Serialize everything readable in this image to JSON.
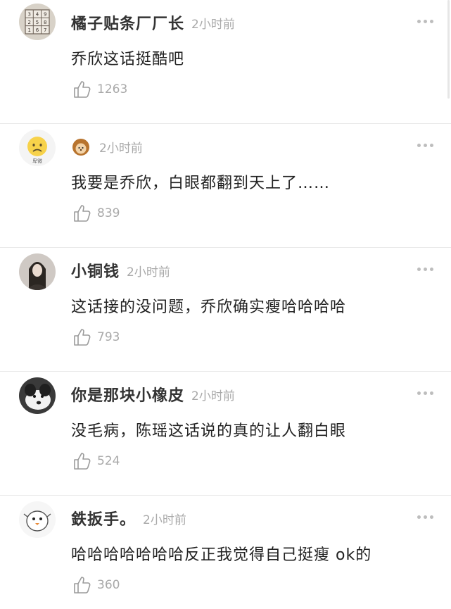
{
  "comments": [
    {
      "username": "橘子贴条厂厂长",
      "time": "2小时前",
      "text": "乔欣这话挺酷吧",
      "likes": "1263",
      "avatar_icon": "number-grid-avatar"
    },
    {
      "username": "",
      "time": "2小时前",
      "text": "我要是乔欣，白眼都翻到天上了……",
      "likes": "839",
      "avatar_icon": "sad-emoji-avatar",
      "badge_icon": "hedgehog-emoji-icon"
    },
    {
      "username": "小铜钱",
      "time": "2小时前",
      "text": "这话接的没问题，乔欣确实瘦哈哈哈哈",
      "likes": "793",
      "avatar_icon": "portrait-avatar"
    },
    {
      "username": "你是那块小橡皮",
      "time": "2小时前",
      "text": "没毛病，陈瑶这话说的真的让人翻白眼",
      "likes": "524",
      "avatar_icon": "dog-avatar"
    },
    {
      "username": "鉄扳手。",
      "time": "2小时前",
      "text": "哈哈哈哈哈哈哈反正我觉得自己挺瘦 ok的",
      "likes": "360",
      "avatar_icon": "cartoon-bird-avatar"
    }
  ],
  "colors": {
    "username": "#333333",
    "meta": "#a9a9a9",
    "text": "#222222",
    "divider": "#e9e9e9"
  }
}
